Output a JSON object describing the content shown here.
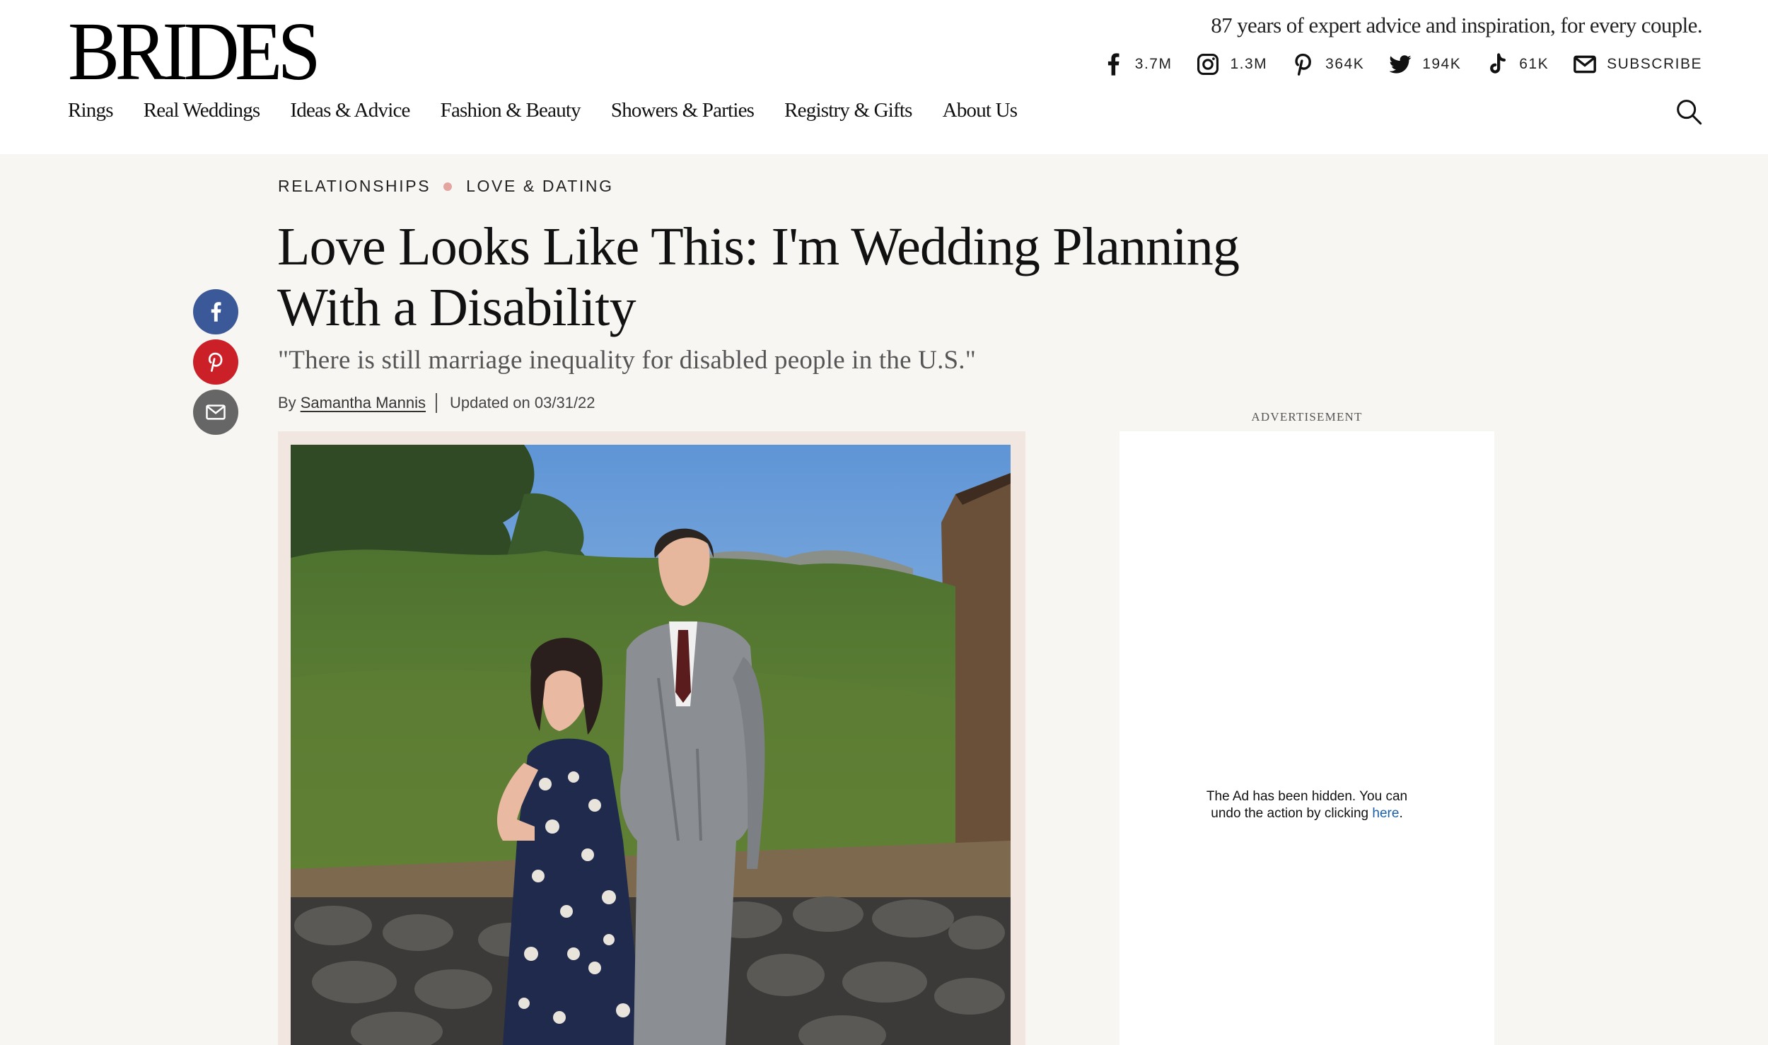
{
  "header": {
    "logo": "BRIDES",
    "tagline": "87 years of expert advice and inspiration, for every couple.",
    "socials": [
      {
        "network": "facebook",
        "icon": "facebook-icon",
        "count": "3.7M"
      },
      {
        "network": "instagram",
        "icon": "instagram-icon",
        "count": "1.3M"
      },
      {
        "network": "pinterest",
        "icon": "pinterest-icon",
        "count": "364K"
      },
      {
        "network": "twitter",
        "icon": "twitter-icon",
        "count": "194K"
      },
      {
        "network": "tiktok",
        "icon": "tiktok-icon",
        "count": "61K"
      },
      {
        "network": "email",
        "icon": "mail-icon",
        "count": "SUBSCRIBE"
      }
    ],
    "nav": [
      "Rings",
      "Real Weddings",
      "Ideas & Advice",
      "Fashion & Beauty",
      "Showers & Parties",
      "Registry & Gifts",
      "About Us"
    ],
    "search_icon": "search-icon"
  },
  "share": {
    "buttons": [
      {
        "network": "facebook",
        "icon": "facebook-icon",
        "color": "#3b5998"
      },
      {
        "network": "pinterest",
        "icon": "pinterest-icon",
        "color": "#cb2027"
      },
      {
        "network": "email",
        "icon": "mail-icon",
        "color": "#666666"
      }
    ]
  },
  "article": {
    "breadcrumbs": [
      "RELATIONSHIPS",
      "LOVE & DATING"
    ],
    "title": "Love Looks Like This: I'm Wedding Planning With a Disability",
    "dek": "\"There is still marriage inequality for disabled people in the U.S.\"",
    "byline_prefix": "By",
    "author": "Samantha Mannis",
    "updated": "Updated on 03/31/22"
  },
  "ad": {
    "label": "ADVERTISEMENT",
    "message_line1": "The Ad has been hidden. You can",
    "message_line2": "undo the action by clicking",
    "link_text": "here",
    "message_end": "."
  },
  "colors": {
    "page_bg": "#f8f6f3",
    "breadcrumb_dot": "#e4a4a0",
    "ad_link": "#1a5fa8"
  }
}
